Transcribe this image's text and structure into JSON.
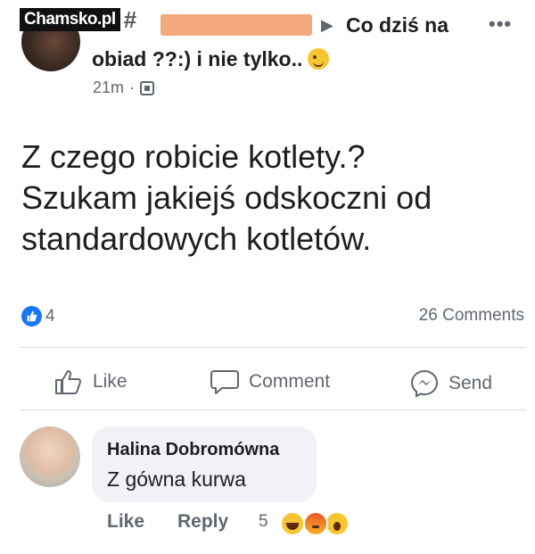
{
  "watermark": {
    "text": "Chamsko.pl"
  },
  "post": {
    "group_name_line1": "Co dziś na",
    "group_name_line2": "obiad ??:) i nie tylko..",
    "time": "21m",
    "more_label": "•••",
    "text_line1": "Z czego robicie kotlety.?",
    "text_line2": "Szukam jakiejś odskoczni od",
    "text_line3": "standardowych kotletów.",
    "reaction_count": "4",
    "comments_count": "26 Comments"
  },
  "actions": {
    "like": "Like",
    "comment": "Comment",
    "send": "Send"
  },
  "comment": {
    "author": "Halina Dobromówna",
    "text": "Z gówna kurwa",
    "like_label": "Like",
    "reply_label": "Reply",
    "reaction_count": "5"
  },
  "colors": {
    "accent": "#1877f2",
    "secondary_text": "#606770",
    "bubble_bg": "#f0f2f5"
  }
}
